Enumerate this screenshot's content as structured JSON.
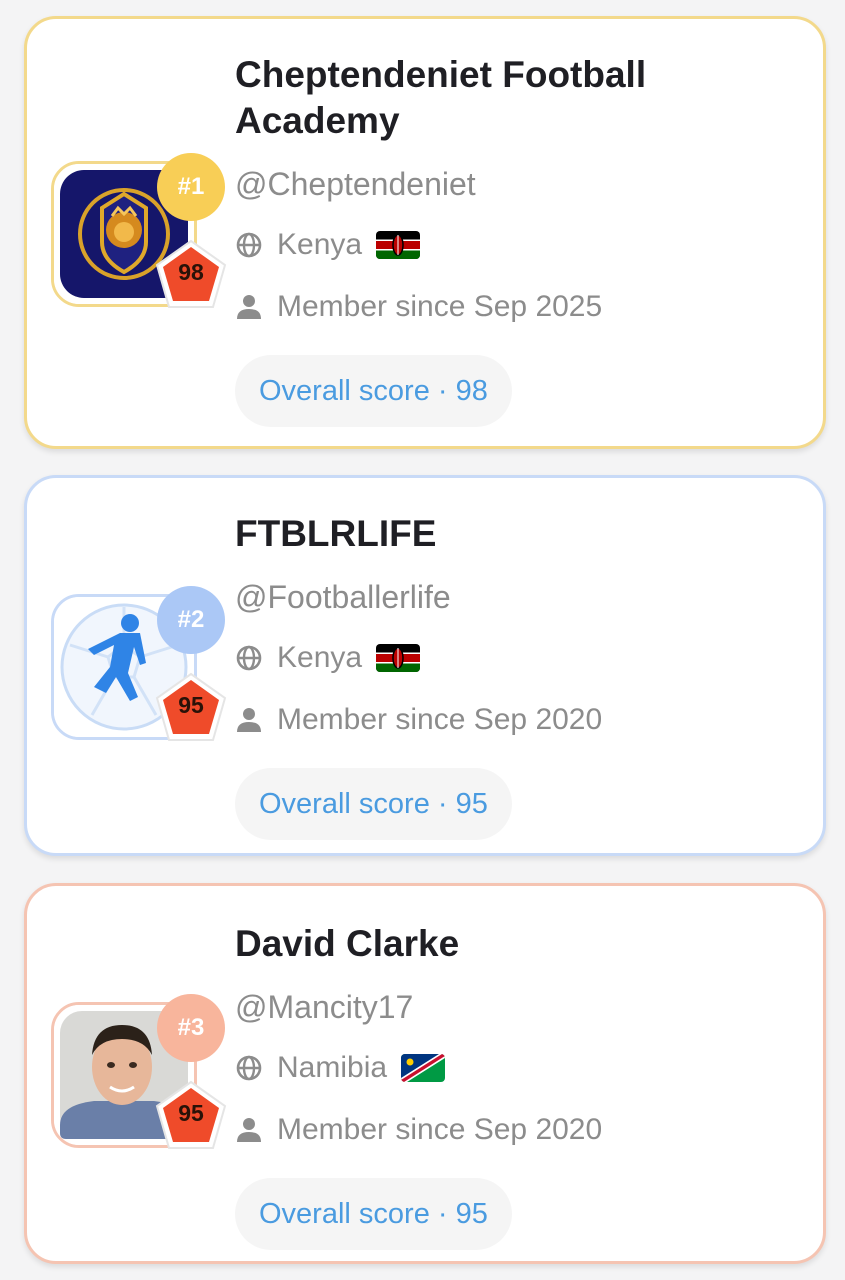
{
  "cards": [
    {
      "rank": "#1",
      "score": "98",
      "name": "Cheptendeniet Football Academy",
      "handle": "@Cheptendeniet",
      "country": "Kenya",
      "member_since": "Member since Sep 2025",
      "overall_score_label": "Overall score · 98",
      "avatar_icon": "lion-crest-logo",
      "flag_icon": "kenya-flag",
      "accent": "#f3d98b"
    },
    {
      "rank": "#2",
      "score": "95",
      "name": "FTBLRLIFE",
      "handle": "@Footballerlife",
      "country": "Kenya",
      "member_since": "Member since Sep 2020",
      "overall_score_label": "Overall score · 95",
      "avatar_icon": "footballer-silhouette-logo",
      "flag_icon": "kenya-flag",
      "accent": "#c8daf7"
    },
    {
      "rank": "#3",
      "score": "95",
      "name": "David Clarke",
      "handle": "@Mancity17",
      "country": "Namibia",
      "member_since": "Member since Sep 2020",
      "overall_score_label": "Overall score · 95",
      "avatar_icon": "profile-photo",
      "flag_icon": "namibia-flag",
      "accent": "#f5c4b2"
    }
  ],
  "icons": {
    "globe": "globe-icon",
    "person": "person-icon"
  },
  "colors": {
    "score_badge": "#ef4b2a",
    "link": "#4a9be0"
  }
}
